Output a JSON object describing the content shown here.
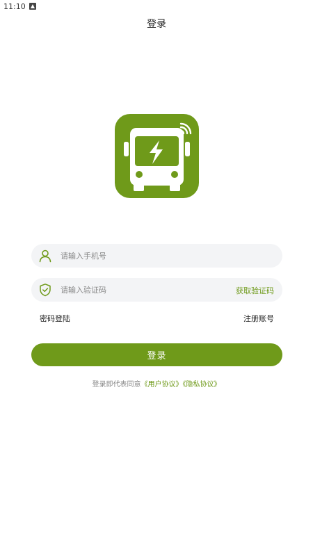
{
  "status_bar": {
    "time": "11:10",
    "notification_icon": "a-icon"
  },
  "header": {
    "title": "登录"
  },
  "app_logo": {
    "icon": "electric-bus-icon",
    "color": "#6f9a1a"
  },
  "phone_field": {
    "icon": "user-icon",
    "placeholder": "请输入手机号",
    "value": ""
  },
  "code_field": {
    "icon": "shield-check-icon",
    "placeholder": "请输入验证码",
    "value": "",
    "get_code_label": "获取验证码"
  },
  "links": {
    "password_login": "密码登陆",
    "register": "注册账号"
  },
  "login_button": {
    "label": "登录"
  },
  "agreement": {
    "prefix": "登录即代表同意",
    "user_agreement": "《用户协议》",
    "privacy_policy": "《隐私协议》"
  },
  "colors": {
    "accent": "#6f9a1a",
    "field_bg": "#f3f4f6",
    "text_muted": "#888888"
  }
}
